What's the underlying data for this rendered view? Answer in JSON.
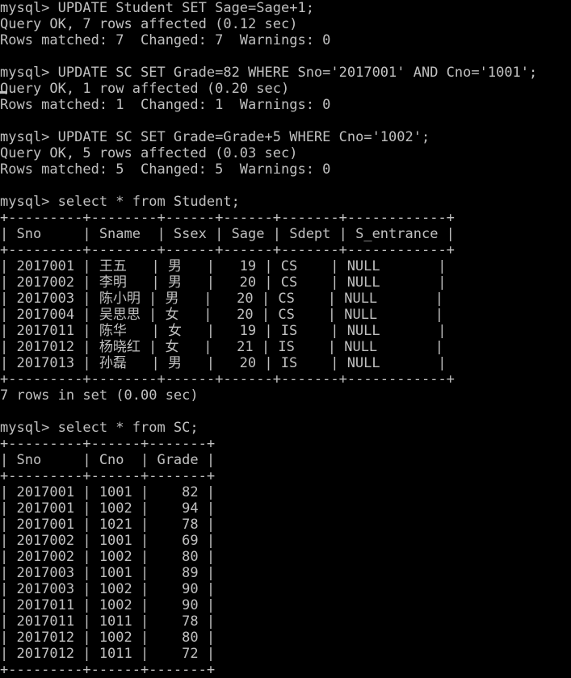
{
  "terminal": {
    "colors": {
      "background": "#000000",
      "foreground": "#c0c0c0"
    },
    "lines": [
      "mysql> UPDATE Student SET Sage=Sage+1;",
      "Query OK, 7 rows affected (0.12 sec)",
      "Rows matched: 7  Changed: 7  Warnings: 0",
      "",
      "mysql> UPDATE SC SET Grade=82 WHERE Sno='2017001' AND Cno='1001';",
      "Query OK, 1 row affected (0.20 sec)",
      "Rows matched: 1  Changed: 1  Warnings: 0",
      "",
      "mysql> UPDATE SC SET Grade=Grade+5 WHERE Cno='1002';",
      "Query OK, 5 rows affected (0.03 sec)",
      "Rows matched: 5  Changed: 5  Warnings: 0",
      "",
      "mysql> select * from Student;",
      "+---------+--------+------+------+-------+------------+",
      "| Sno     | Sname  | Ssex | Sage | Sdept | S_entrance |",
      "+---------+--------+------+------+-------+------------+",
      "| 2017001 | 王五   | 男   |   19 | CS    | NULL       |",
      "| 2017002 | 李明   | 男   |   20 | CS    | NULL       |",
      "| 2017003 | 陈小明 | 男   |   20 | CS    | NULL       |",
      "| 2017004 | 吴思思 | 女   |   20 | CS    | NULL       |",
      "| 2017011 | 陈华   | 女   |   19 | IS    | NULL       |",
      "| 2017012 | 杨晓红 | 女   |   21 | IS    | NULL       |",
      "| 2017013 | 孙磊   | 男   |   20 | IS    | NULL       |",
      "+---------+--------+------+------+-------+------------+",
      "7 rows in set (0.00 sec)",
      "",
      "mysql> select * from SC;",
      "+---------+------+-------+",
      "| Sno     | Cno  | Grade |",
      "+---------+------+-------+",
      "| 2017001 | 1001 |    82 |",
      "| 2017001 | 1002 |    94 |",
      "| 2017001 | 1021 |    78 |",
      "| 2017002 | 1001 |    69 |",
      "| 2017002 | 1002 |    80 |",
      "| 2017003 | 1001 |    89 |",
      "| 2017003 | 1002 |    90 |",
      "| 2017011 | 1002 |    90 |",
      "| 2017011 | 1011 |    78 |",
      "| 2017012 | 1002 |    80 |",
      "| 2017012 | 1011 |    72 |",
      "+---------+------+-------+"
    ]
  }
}
